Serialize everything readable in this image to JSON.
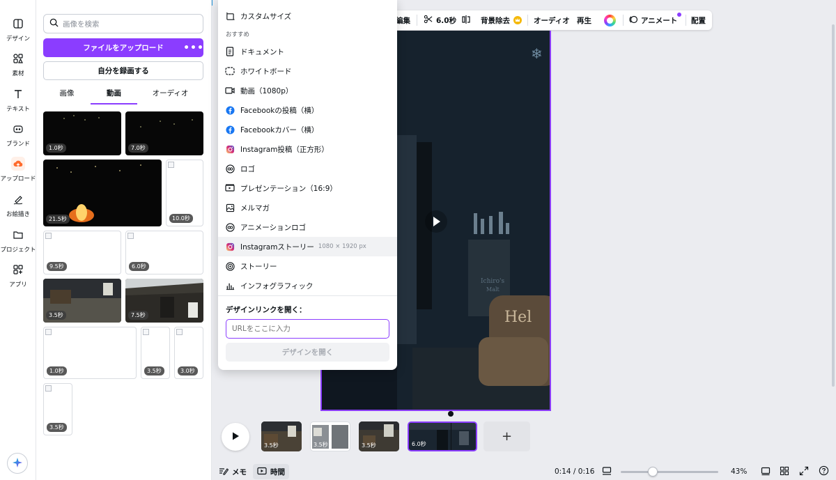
{
  "rail": {
    "items": [
      {
        "label": "デザイン",
        "icon": "design-icon"
      },
      {
        "label": "素材",
        "icon": "elements-icon"
      },
      {
        "label": "テキスト",
        "icon": "text-icon"
      },
      {
        "label": "ブランド",
        "icon": "brand-icon"
      },
      {
        "label": "アップロード",
        "icon": "upload-cloud-icon"
      },
      {
        "label": "お絵描き",
        "icon": "draw-icon"
      },
      {
        "label": "プロジェクト",
        "icon": "folder-icon"
      },
      {
        "label": "アプリ",
        "icon": "apps-icon"
      }
    ]
  },
  "panel": {
    "search_placeholder": "画像を検索",
    "upload_label": "ファイルをアップロード",
    "upload_more": "•••",
    "record_label": "自分を録画する",
    "tabs": [
      "画像",
      "動画",
      "オーディオ"
    ],
    "active_tab": "動画",
    "videos": [
      {
        "duration": "1.0秒"
      },
      {
        "duration": "7.0秒"
      },
      {
        "duration": "21.5秒"
      },
      {
        "duration": "10.0秒"
      },
      {
        "duration": "9.5秒"
      },
      {
        "duration": "6.0秒"
      },
      {
        "duration": "3.5秒"
      },
      {
        "duration": "7.5秒"
      },
      {
        "duration": "1.0秒"
      },
      {
        "duration": "3.5秒"
      },
      {
        "duration": "3.0秒"
      },
      {
        "duration": "3.5秒"
      }
    ]
  },
  "menu": {
    "custom_size": "カスタムサイズ",
    "section_label": "おすすめ",
    "items": [
      {
        "label": "ドキュメント",
        "icon": "document-icon"
      },
      {
        "label": "ホワイトボード",
        "icon": "whiteboard-icon"
      },
      {
        "label": "動画（1080p）",
        "icon": "video-icon"
      },
      {
        "label": "Facebookの投稿（横）",
        "icon": "facebook-icon"
      },
      {
        "label": "Facebookカバー（横）",
        "icon": "facebook-icon"
      },
      {
        "label": "Instagram投稿（正方形）",
        "icon": "instagram-icon"
      },
      {
        "label": "ロゴ",
        "icon": "logo-icon"
      },
      {
        "label": "プレゼンテーション（16:9）",
        "icon": "presentation-icon"
      },
      {
        "label": "メルマガ",
        "icon": "email-icon"
      },
      {
        "label": "アニメーションロゴ",
        "icon": "logo-icon"
      },
      {
        "label": "Instagramストーリー",
        "icon": "instagram-icon",
        "dim": "1080 × 1920 px"
      },
      {
        "label": "ストーリー",
        "icon": "story-icon"
      },
      {
        "label": "インフォグラフィック",
        "icon": "infographic-icon"
      }
    ],
    "open_link_title": "デザインリンクを開く：",
    "url_placeholder": "URLをここに入力",
    "open_button": "デザインを開く"
  },
  "toolbar": {
    "edit_partial": "編集",
    "duration": "6.0秒",
    "bg_remove": "背景除去",
    "audio": "オーディオ",
    "play": "再生",
    "animate": "アニメート",
    "arrange": "配置"
  },
  "timeline": {
    "clips": [
      {
        "duration": "3.5秒"
      },
      {
        "duration": "3.5秒"
      },
      {
        "duration": "3.5秒"
      },
      {
        "duration": "6.0秒",
        "selected": true
      }
    ],
    "add_label": "+"
  },
  "footer": {
    "notes": "メモ",
    "time": "時間",
    "timecode": "0:14 / 0:16",
    "zoom": "43%",
    "zoom_fraction": 0.33
  },
  "colors": {
    "accent": "#8b3dff",
    "canvas_bg": "#ebecf0"
  }
}
